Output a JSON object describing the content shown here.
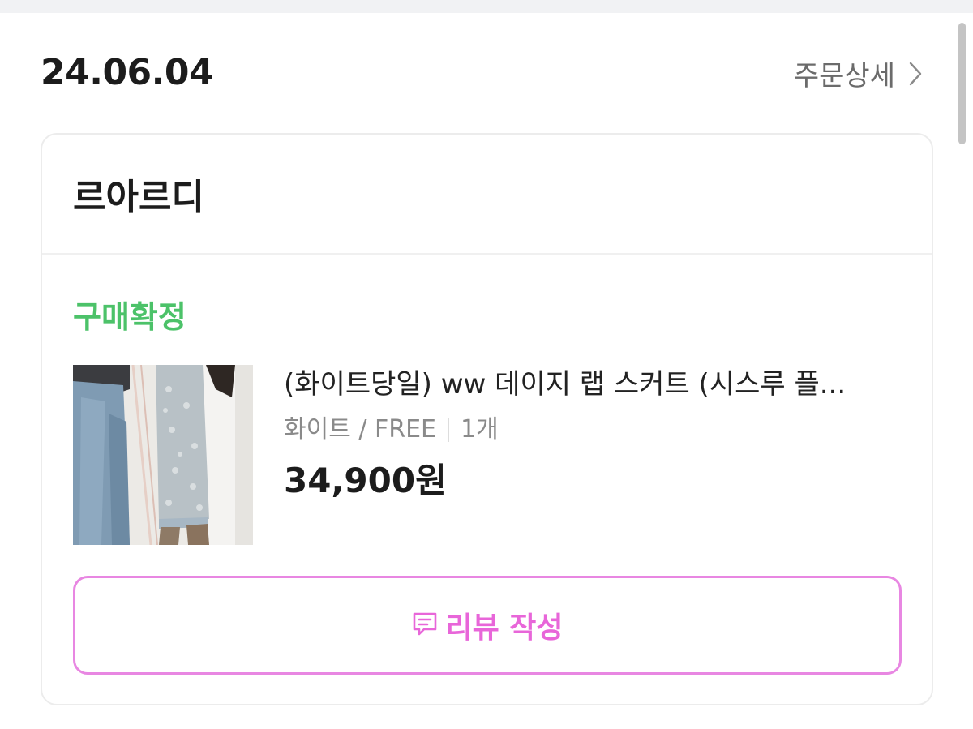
{
  "order": {
    "date": "24.06.04",
    "detail_link_label": "주문상세"
  },
  "store": {
    "name": "르아르디"
  },
  "status": {
    "label": "구매확정",
    "color": "#4cc269"
  },
  "product": {
    "title": "(화이트당일) ww 데이지 랩 스커트 (시스루 플...",
    "option": "화이트 / FREE",
    "quantity": "1개",
    "price": "34,900원"
  },
  "review_button": {
    "label": "리뷰 작성",
    "icon": "review-write-icon",
    "accent_color": "#e866d9"
  },
  "icons": {
    "detail_link": "chevron-right-icon"
  }
}
